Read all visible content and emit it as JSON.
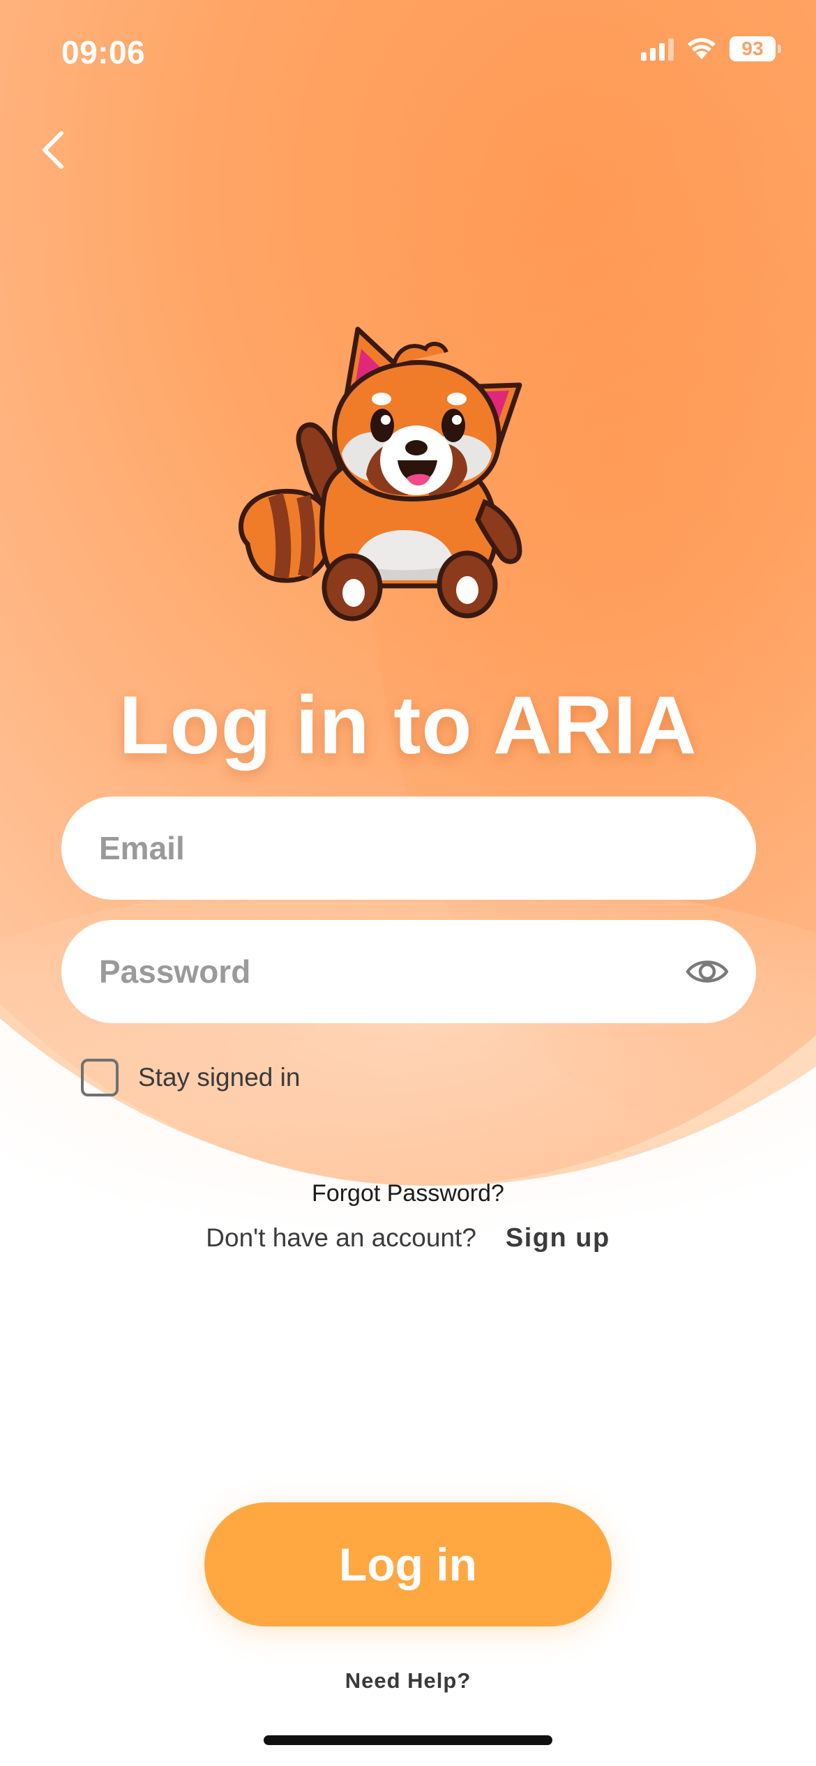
{
  "status_bar": {
    "time": "09:06",
    "battery": "93",
    "icons": [
      "cellular-signal-icon",
      "wifi-icon",
      "battery-icon"
    ]
  },
  "nav": {
    "back_icon": "chevron-left-icon"
  },
  "mascot": {
    "description_icon": "red-panda-mascot"
  },
  "title": "Log in to ARIA",
  "form": {
    "email": {
      "value": "",
      "placeholder": "Email"
    },
    "password": {
      "value": "",
      "placeholder": "Password",
      "toggle_icon": "eye-icon"
    },
    "stay_signed_in": {
      "label": "Stay signed in",
      "checked": false
    }
  },
  "links": {
    "forgot_password": "Forgot Password?",
    "signup_prompt": "Don't have an account?",
    "signup": "Sign up"
  },
  "login_button": "Log in",
  "need_help": "Need Help?",
  "colors": {
    "accent": "#ffa842",
    "background_gradient": "#ff9a55",
    "text_dark": "#3b3b3b"
  }
}
